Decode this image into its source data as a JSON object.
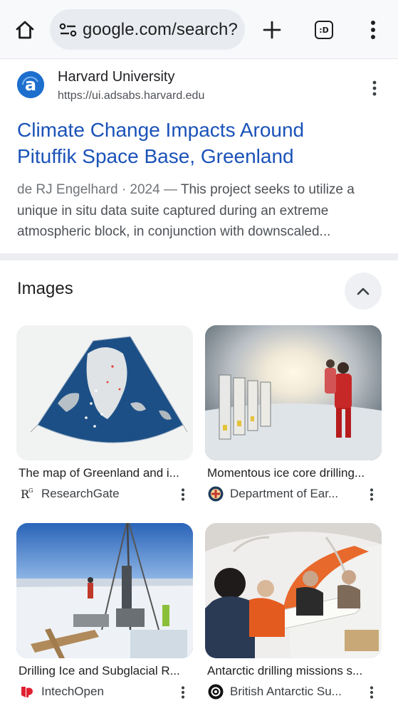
{
  "browser": {
    "url": "google.com/search?",
    "tab_icon_text": ":D",
    "icons": [
      "home-icon",
      "tune-icon",
      "plus-icon",
      "tab-switcher-icon",
      "more-vert-icon"
    ]
  },
  "result": {
    "site_name": "Harvard University",
    "site_url": "https://ui.adsabs.harvard.edu",
    "favicon_letter": "a",
    "title_line1": "Climate Change Impacts Around",
    "title_line2": "Pituffik Space Base, Greenland",
    "snippet_meta": "de RJ Engelhard · 2024 — ",
    "snippet_text": "This project seeks to utilize a unique in situ data suite captured during an extreme atmospheric block, in conjunction with downscaled..."
  },
  "images": {
    "heading": "Images",
    "cards": [
      {
        "title": "The map of Greenland and i...",
        "source": "ResearchGate",
        "source_icon": "researchgate-icon",
        "icon_text": "R"
      },
      {
        "title": "Momentous ice core drilling...",
        "source": "Department of Ear...",
        "source_icon": "university-crest-icon"
      },
      {
        "title": "Drilling Ice and Subglacial R...",
        "source": "IntechOpen",
        "source_icon": "intechopen-icon"
      },
      {
        "title": "Antarctic drilling missions s...",
        "source": "British Antarctic Su...",
        "source_icon": "bas-icon"
      }
    ]
  },
  "colors": {
    "link_blue": "#1a52b8",
    "favicon_blue": "#1d6fce",
    "url_bar_bg": "#e8ebf0",
    "divider": "#eceef2"
  }
}
